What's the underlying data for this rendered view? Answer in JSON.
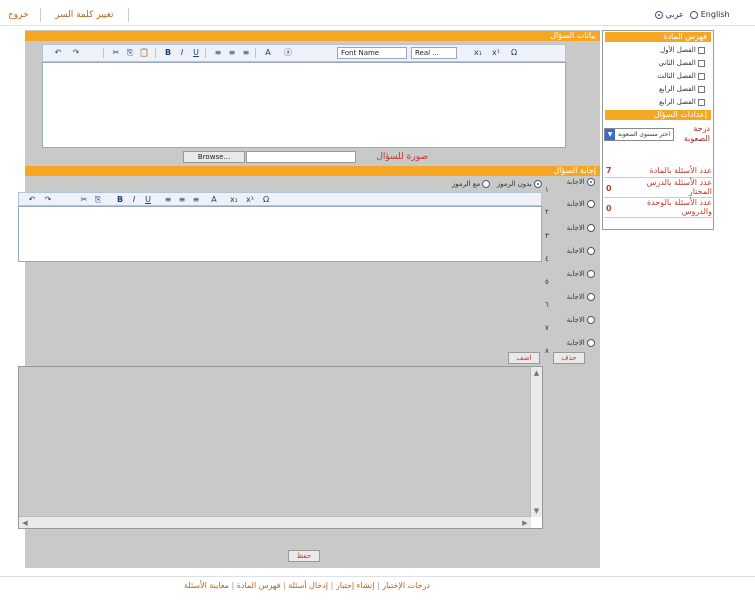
{
  "top": {
    "logout": "خروج",
    "change_password": "تغيير كلمة السر",
    "lang_arabic": "عربي",
    "lang_english": "English"
  },
  "sidebar": {
    "subject_index_title": "فهرس المادة",
    "items": [
      {
        "label": "الفصل الأول",
        "checked": false
      },
      {
        "label": "الفصل الثاني",
        "checked": false
      },
      {
        "label": "الفصل الثالث",
        "checked": false
      },
      {
        "label": "الفصل الرابع",
        "checked": false
      },
      {
        "label": "الفصل الرابع",
        "checked": false
      }
    ],
    "settings_title": "إعدادات السؤال",
    "difficulty_label": "درجة الصعوبة",
    "difficulty_value": "اختر مستوى الصعوبة",
    "stats": [
      {
        "label": "عدد الأسئلة بالمادة",
        "value": "7"
      },
      {
        "label": "عدد الأسئلة بالدرس المختار",
        "value": "0"
      },
      {
        "label": "عدد الأسئلة بالوحدة والدروس",
        "value": "0"
      }
    ]
  },
  "question_section": {
    "title": "بيانات السؤال",
    "font_name": "Font Name",
    "font_size": "Real ...",
    "browse": "Browse...",
    "image_label": "صورة للسؤال"
  },
  "answer_section": {
    "title": "إجابة السؤال",
    "no_symbols": "بدون الرموز",
    "with_symbols": "مع الرموز",
    "answers": [
      {
        "label": "الاجابة",
        "num": "١",
        "selected": true
      },
      {
        "label": "الاجابة",
        "num": "٢",
        "selected": false
      },
      {
        "label": "الاجابة",
        "num": "٣",
        "selected": false
      },
      {
        "label": "الاجابة",
        "num": "٤",
        "selected": false
      },
      {
        "label": "الاجابة",
        "num": "٥",
        "selected": false
      },
      {
        "label": "الاجابة",
        "num": "٦",
        "selected": false
      },
      {
        "label": "الاجابة",
        "num": "٧",
        "selected": false
      },
      {
        "label": "الاجابة",
        "num": "٨",
        "selected": false
      }
    ],
    "add_button": "اضف",
    "delete_button": "حذف",
    "save_button": "حفظ"
  },
  "bottom_nav": {
    "items": [
      "درجات الإختبار",
      "إنشاء إختبار",
      "إدخال أسئلة",
      "فهرس المادة",
      "معاينة الأسئلة"
    ]
  },
  "colors": {
    "orange": "#f5a623",
    "panel_gray": "#c9c9c9",
    "accent_red": "#c0392b"
  }
}
